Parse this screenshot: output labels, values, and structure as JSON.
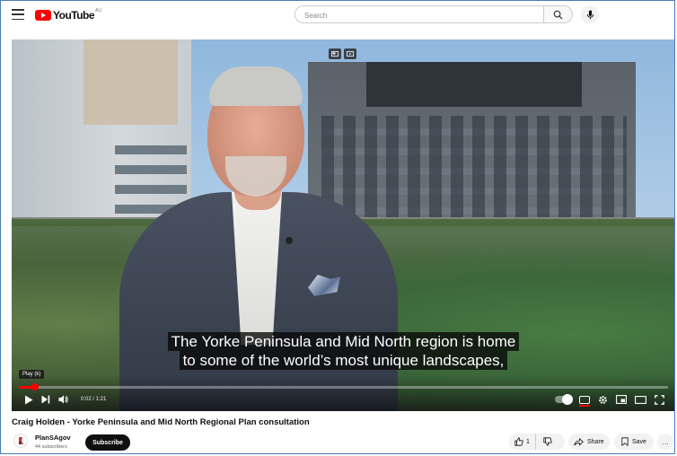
{
  "header": {
    "logo_text": "YouTube",
    "logo_region": "AU",
    "search_placeholder": "Search",
    "menu_icon": "hamburger-menu-icon",
    "search_icon": "magnifier-icon",
    "mic_icon": "microphone-icon"
  },
  "player": {
    "captions": [
      "The Yorke Peninsula and Mid North region is home",
      "to some of the world’s most unique landscapes,"
    ],
    "tooltip": "Play (k)",
    "time": "0:02 / 1:21",
    "progress": 0.025,
    "controls_left": [
      "play-icon",
      "next-icon",
      "volume-icon"
    ],
    "controls_right": [
      "autoplay-toggle",
      "subtitles-icon",
      "settings-icon",
      "miniplayer-icon",
      "theater-icon",
      "fullscreen-icon"
    ],
    "accent": "#ff0000"
  },
  "video": {
    "title": "Craig Holden - Yorke Peninsula and Mid North Regional Plan consultation"
  },
  "channel": {
    "name": "PlanSAgov",
    "subscribers": "44 subscribers",
    "subscribe_label": "Subscribe"
  },
  "actions": {
    "like_count": "1",
    "share_label": "Share",
    "save_label": "Save",
    "more_label": "…"
  }
}
